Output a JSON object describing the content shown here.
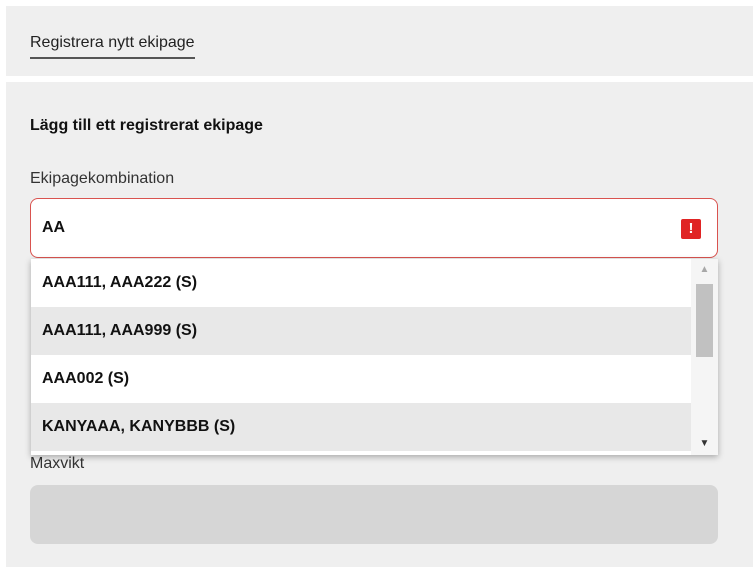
{
  "tabs": {
    "active_label": "Registrera nytt ekipage"
  },
  "form": {
    "heading": "Lägg till ett registrerat ekipage",
    "combination_label": "Ekipagekombination",
    "combination_value": "AA",
    "error_icon_glyph": "!",
    "error_color": "#e02424",
    "options": [
      "AAA111, AAA222 (S)",
      "AAA111, AAA999 (S)",
      "AAA002 (S)",
      "KANYAAA, KANYBBB (S)"
    ],
    "maxvikt_label": "Maxvikt",
    "maxvikt_value": ""
  },
  "icons": {
    "error": "exclamation-icon",
    "scroll_up": "triangle-up-icon",
    "scroll_down": "triangle-down-icon"
  }
}
